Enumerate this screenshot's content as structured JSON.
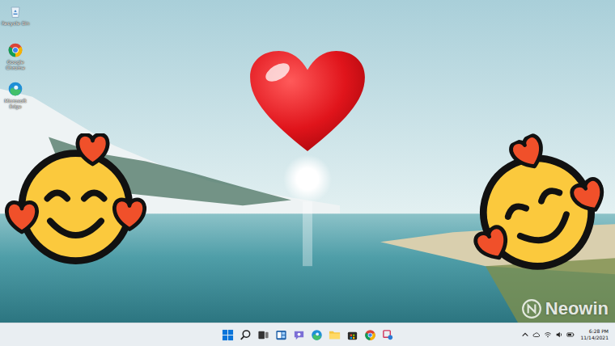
{
  "desktop": {
    "icons": [
      {
        "label": "Recycle Bin"
      },
      {
        "label": "Google Chrome"
      },
      {
        "label": "Microsoft Edge"
      }
    ]
  },
  "taskbar": {
    "clock": {
      "time": "6:28 PM",
      "date": "11/14/2021"
    }
  },
  "watermark": {
    "text": "Neowin"
  }
}
